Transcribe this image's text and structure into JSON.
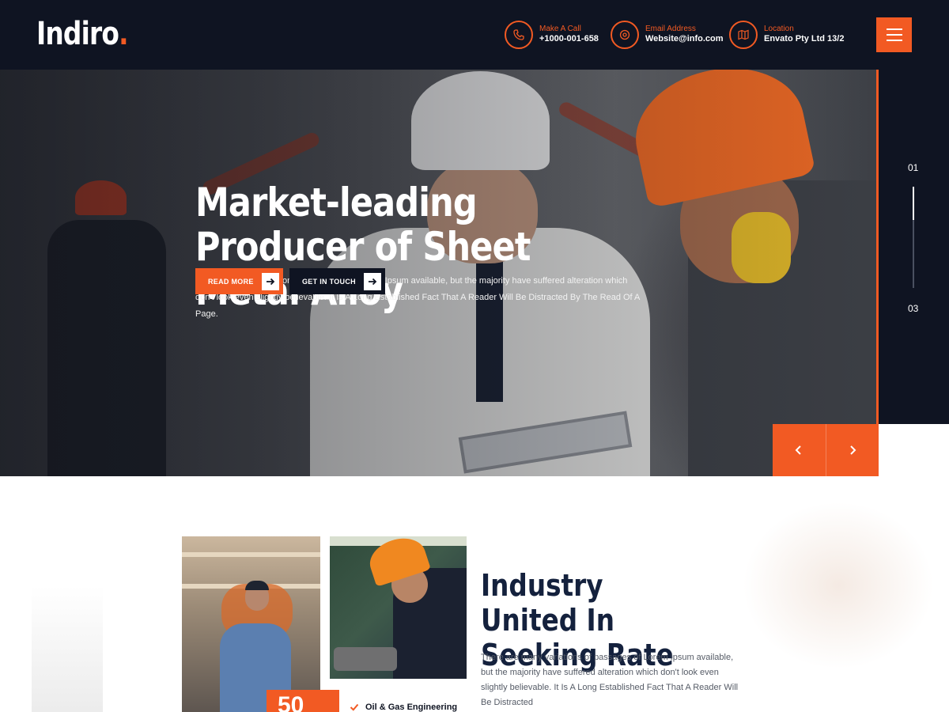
{
  "header": {
    "logo": "Indiro",
    "logo_dot": ".",
    "contacts": [
      {
        "label": "Make A Call",
        "value": "+1000-001-658",
        "icon": "phone-icon"
      },
      {
        "label": "Email Address",
        "value": "Website@info.com",
        "icon": "email-icon"
      },
      {
        "label": "Location",
        "value": "Envato Pty Ltd 13/2",
        "icon": "map-icon"
      }
    ],
    "menu_icon": "hamburger-icon"
  },
  "hero": {
    "title": "Market-leading Producer of Sheet Metal Alloy",
    "description": "There are many variations of passages of Lorem Ipsum available, but the majority have suffered alteration which don't look even slightly believable. It Is A Long Established Fact That A Reader Will Be Distracted By The Read Of A Page.",
    "btn_read": "READ MORE",
    "btn_touch": "GET IN TOUCH",
    "slide_current": "01",
    "slide_total": "03",
    "slide_progress": 0.33
  },
  "about": {
    "badge_number": "50",
    "service_label": "Oil & Gas Engineering",
    "title": "Industry United In Seeking Rate",
    "description": "There are many variations of passages of Lorem Ipsum available, but the majority have suffered alteration which don't look even slightly believable. It Is A Long Established Fact That A Reader Will Be Distracted"
  },
  "colors": {
    "accent": "#f25a23",
    "dark": "#0f1422",
    "heading": "#14213d"
  }
}
